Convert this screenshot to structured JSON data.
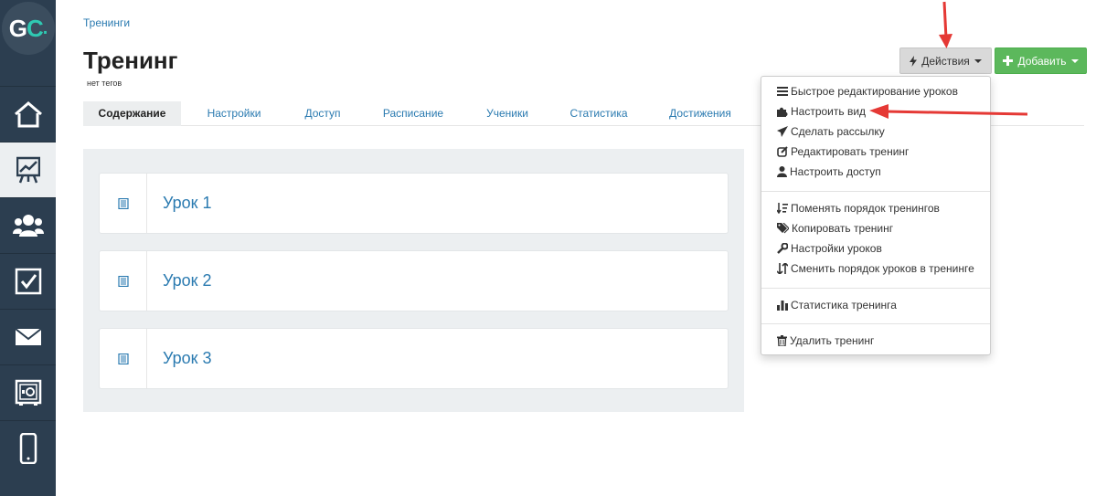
{
  "logo": {
    "part1": "G",
    "part2": "C",
    "dot": "."
  },
  "sidebar": {
    "items": [
      {
        "name": "home-icon"
      },
      {
        "name": "training-icon",
        "active": true
      },
      {
        "name": "users-icon"
      },
      {
        "name": "tasks-icon"
      },
      {
        "name": "mail-icon"
      },
      {
        "name": "safe-icon"
      },
      {
        "name": "mobile-icon"
      }
    ]
  },
  "header": {
    "breadcrumb": "Тренинги",
    "title": "Тренинг",
    "tags": "нет тегов"
  },
  "tabs": [
    {
      "label": "Содержание",
      "active": true
    },
    {
      "label": "Настройки"
    },
    {
      "label": "Доступ"
    },
    {
      "label": "Расписание"
    },
    {
      "label": "Ученики"
    },
    {
      "label": "Статистика"
    },
    {
      "label": "Достижения"
    }
  ],
  "buttons": {
    "actions": "Действия",
    "add": "Добавить"
  },
  "dropdown": {
    "items": [
      {
        "label": "Быстрое редактирование уроков",
        "icon": "list-icon"
      },
      {
        "label": "Настроить вид",
        "icon": "puzzle-icon"
      },
      {
        "label": "Сделать рассылку",
        "icon": "send-icon"
      },
      {
        "label": "Редактировать тренинг",
        "icon": "edit-icon"
      },
      {
        "label": "Настроить доступ",
        "icon": "user-icon"
      },
      {
        "label": "Поменять порядок тренингов",
        "icon": "sort-order-icon"
      },
      {
        "label": "Копировать тренинг",
        "icon": "tags-icon"
      },
      {
        "label": "Настройки уроков",
        "icon": "wrench-icon"
      },
      {
        "label": "Сменить порядок уроков в тренинге",
        "icon": "swap-icon"
      },
      {
        "label": "Статистика тренинга",
        "icon": "bar-chart-icon"
      },
      {
        "label": "Удалить тренинг",
        "icon": "trash-icon"
      }
    ]
  },
  "lessons": [
    {
      "title": "Урок 1"
    },
    {
      "title": "Урок 2"
    },
    {
      "title": "Урок 3"
    }
  ],
  "colors": {
    "sidebar": "#2c3e50",
    "accent_link": "#2a7ab0",
    "add_button": "#5cb85c",
    "annotation_arrow": "#e53935",
    "logo_accent": "#2fc9b2"
  }
}
